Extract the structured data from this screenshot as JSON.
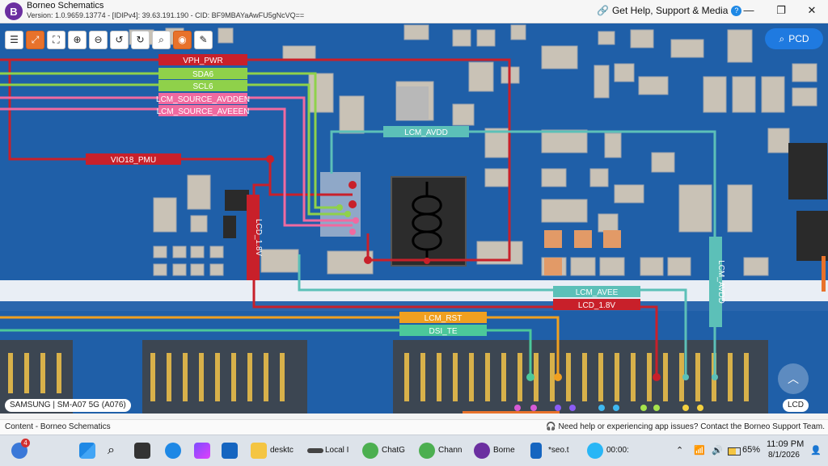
{
  "window": {
    "title": "Borneo Schematics",
    "version": "Version: 1.0.9659.13774 - [IDIPv4]: 39.63.191.190 - CID: BF9MBAYaAwFU5gNcVQ==",
    "help_label": "Get Help, Support & Media",
    "minimize": "—",
    "maximize": "❐",
    "close": "✕"
  },
  "toolbar": [
    {
      "name": "list",
      "glyph": "☰"
    },
    {
      "name": "fit",
      "glyph": "⤢"
    },
    {
      "name": "fullscreen",
      "glyph": "⛶"
    },
    {
      "name": "zoom-in",
      "glyph": "⊕"
    },
    {
      "name": "zoom-out",
      "glyph": "⊖"
    },
    {
      "name": "rotate-left",
      "glyph": "↺"
    },
    {
      "name": "rotate-right",
      "glyph": "↻"
    },
    {
      "name": "search",
      "glyph": "⌕"
    },
    {
      "name": "mouse",
      "glyph": "◉"
    },
    {
      "name": "draw",
      "glyph": "✎"
    }
  ],
  "pcd": {
    "label": "PCD"
  },
  "model_label": "SAMSUNG | SM-A07 5G (A076)",
  "lcd_label": "LCD",
  "nets": {
    "vph_pwr": "VPH_PWR",
    "sda6": "SDA6",
    "scl6": "SCL6",
    "lcm_source_avdden": "LCM_SOURCE_AVDDEN",
    "lcm_source_aveeen": "LCM_SOURCE_AVEEEN",
    "vio18_pmu": "VIO18_PMU",
    "lcm_avdd": "LCM_AVDD",
    "lcd_1v8_vertical": "LCD_1.8V",
    "lcm_avdd_vertical": "LCM_AVDD",
    "lcm_avee": "LCM_AVEE",
    "lcd_1v8": "LCD_1.8V",
    "lcm_rst": "LCM_RST",
    "dsi_te": "DSI_TE"
  },
  "colors": {
    "board": "#1f5fa8",
    "red": "#c8202a",
    "green": "#8fd14a",
    "pink": "#f06aa0",
    "teal": "#5cc0b8",
    "orange": "#f0a020",
    "accent": "#1f7ae0"
  },
  "status": {
    "left": "Content - Borneo Schematics",
    "right": "Need help or experiencing app issues? Contact the Borneo Support Team."
  },
  "taskbar": {
    "badge": "4",
    "items": [
      "desktc",
      "Local I",
      "ChatG",
      "Chann",
      "Borne",
      "*seo.t",
      "00:00:"
    ],
    "battery": "65%",
    "time": "11:09 PM",
    "date": "8/1/2026"
  }
}
